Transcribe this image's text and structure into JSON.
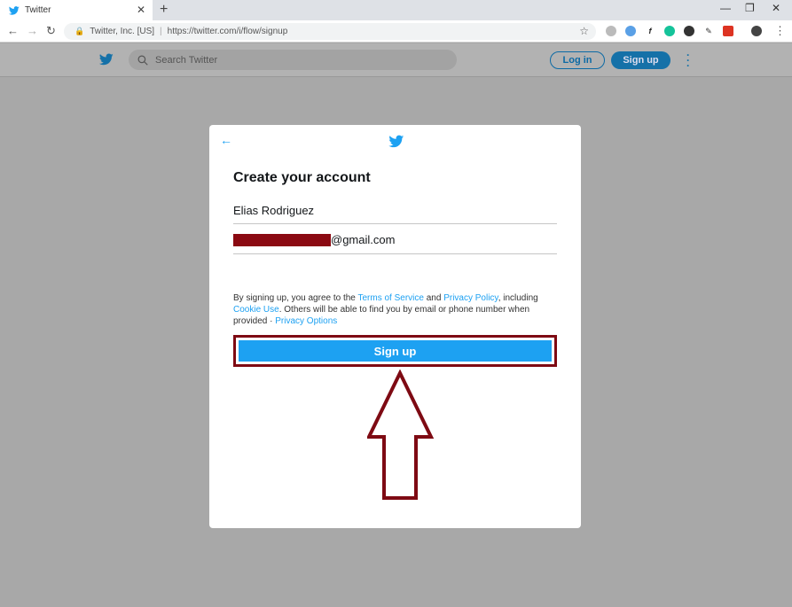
{
  "browser": {
    "tab_title": "Twitter",
    "tab_close": "✕",
    "new_tab": "+",
    "win_min": "—",
    "win_restore": "❐",
    "win_close": "✕",
    "back": "←",
    "forward": "→",
    "reload": "↻",
    "site_identity": "Twitter, Inc. [US]",
    "url": "https://twitter.com/i/flow/signup",
    "menu": "⋮"
  },
  "header": {
    "search_placeholder": "Search Twitter",
    "login_label": "Log in",
    "signup_label": "Sign up"
  },
  "modal": {
    "back_glyph": "←",
    "title": "Create your account",
    "name_value": "Elias Rodriguez",
    "email_suffix": "@gmail.com",
    "terms_prefix": "By signing up, you agree to the ",
    "terms_link": "Terms of Service",
    "terms_and": " and ",
    "privacy_link": "Privacy Policy",
    "terms_including": ", including",
    "cookie_link": "Cookie Use",
    "terms_rest": ". Others will be able to find you by email or phone number when provided · ",
    "privacy_options_link": "Privacy Options",
    "signup_button": "Sign up"
  },
  "colors": {
    "twitter_blue": "#1da1f2",
    "annotation_red": "#7e0a13",
    "overlay_gray": "#a8a8a8"
  }
}
